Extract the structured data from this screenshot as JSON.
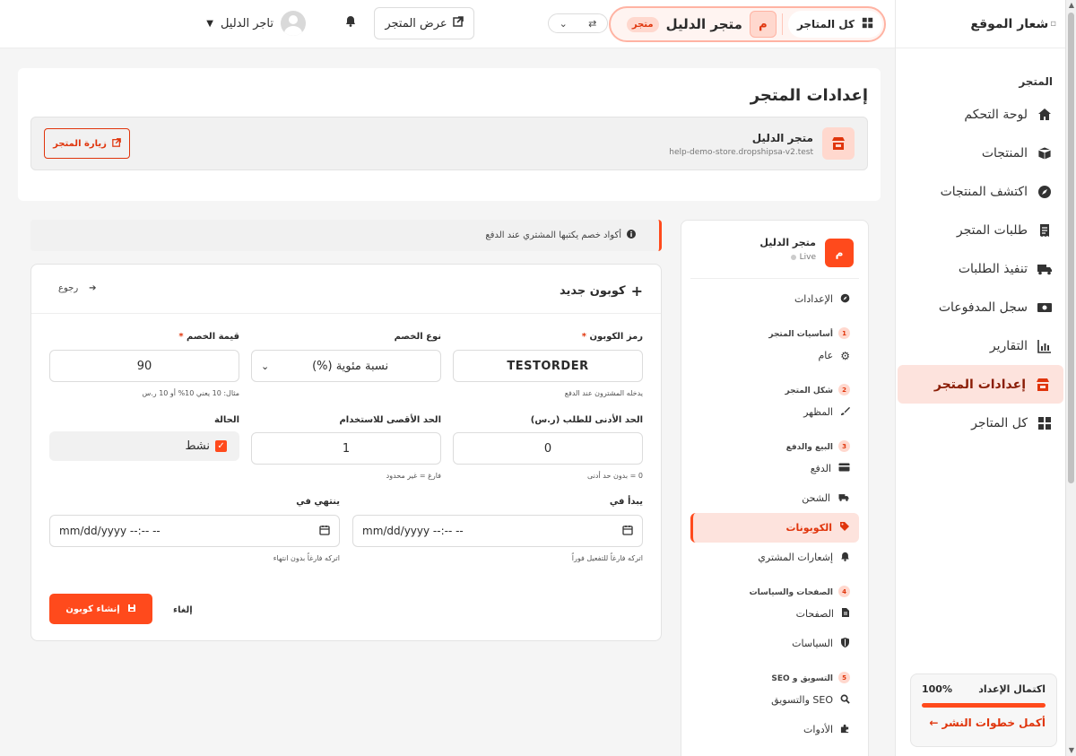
{
  "sidebar": {
    "logo_alt": "شعار الموقع",
    "section_title": "المتجر",
    "items": [
      {
        "label": "لوحة التحكم",
        "icon": "home-icon"
      },
      {
        "label": "المنتجات",
        "icon": "box-icon"
      },
      {
        "label": "اكتشف المنتجات",
        "icon": "compass-icon"
      },
      {
        "label": "طلبات المتجر",
        "icon": "receipt-icon"
      },
      {
        "label": "تنفيذ الطلبات",
        "icon": "truck-icon"
      },
      {
        "label": "سجل المدفوعات",
        "icon": "money-icon"
      },
      {
        "label": "التقارير",
        "icon": "chart-icon"
      },
      {
        "label": "إعدادات المتجر",
        "icon": "store-icon",
        "active": true
      },
      {
        "label": "كل المتاجر",
        "icon": "grid-icon"
      }
    ],
    "completion": {
      "title": "اكتمال الإعداد",
      "percent": "100%",
      "link": "أكمل خطوات النشر ←"
    }
  },
  "topbar": {
    "all_stores": "كل المتاجر",
    "store_initial": "م",
    "store_name": "متجر الدليل",
    "store_badge": "متجر",
    "view_store": "عرض المتجر",
    "user_name": "تاجر الدليل"
  },
  "header": {
    "title": "إعدادات المتجر",
    "store_name": "متجر الدليل",
    "store_url": "help-demo-store.dropshipsa-v2.test",
    "visit_label": "زيارة المتجر"
  },
  "store_nav": {
    "initial": "م",
    "store_name": "متجر الدليل",
    "status": "Live",
    "settings": "الإعدادات",
    "groups": [
      {
        "num": "1",
        "title": "أساسيات المتجر",
        "items": [
          "عام"
        ]
      },
      {
        "num": "2",
        "title": "شكل المتجر",
        "items": [
          "المظهر"
        ]
      },
      {
        "num": "3",
        "title": "البيع والدفع",
        "items": [
          "الدفع",
          "الشحن",
          "الكوبونات",
          "إشعارات المشتري"
        ]
      },
      {
        "num": "4",
        "title": "الصفحات والسياسات",
        "items": [
          "الصفحات",
          "السياسات"
        ]
      },
      {
        "num": "5",
        "title": "التسويق و SEO",
        "items": [
          "SEO والتسويق",
          "الأدوات"
        ]
      }
    ]
  },
  "info_banner": "أكواد خصم يكتبها المشتري عند الدفع",
  "form": {
    "title": "كوبون جديد",
    "back": "رجوع",
    "code_label": "رمز الكوبون",
    "code_value": "TESTORDER",
    "code_hint": "يدخله المشترون عند الدفع",
    "type_label": "نوع الخصم",
    "type_value": "نسبة مئوية (%)",
    "value_label": "قيمة الخصم",
    "value_value": "90",
    "value_hint": "مثال: 10 يعني 10% أو 10 ر.س",
    "min_label": "الحد الأدنى للطلب (ر.س)",
    "min_value": "0",
    "min_hint": "0 = بدون حد أدنى",
    "max_label": "الحد الأقصى للاستخدام",
    "max_value": "1",
    "max_hint": "فارغ = غير محدود",
    "status_label": "الحالة",
    "status_value": "نشط",
    "start_label": "يبدأ في",
    "start_value": "mm/dd/yyyy --:-- --",
    "start_hint": "اتركه فارغاً للتفعيل فوراً",
    "end_label": "ينتهي في",
    "end_value": "mm/dd/yyyy --:-- --",
    "end_hint": "اتركه فارغاً بدون انتهاء",
    "create": "إنشاء كوبون",
    "cancel": "إلغاء"
  }
}
